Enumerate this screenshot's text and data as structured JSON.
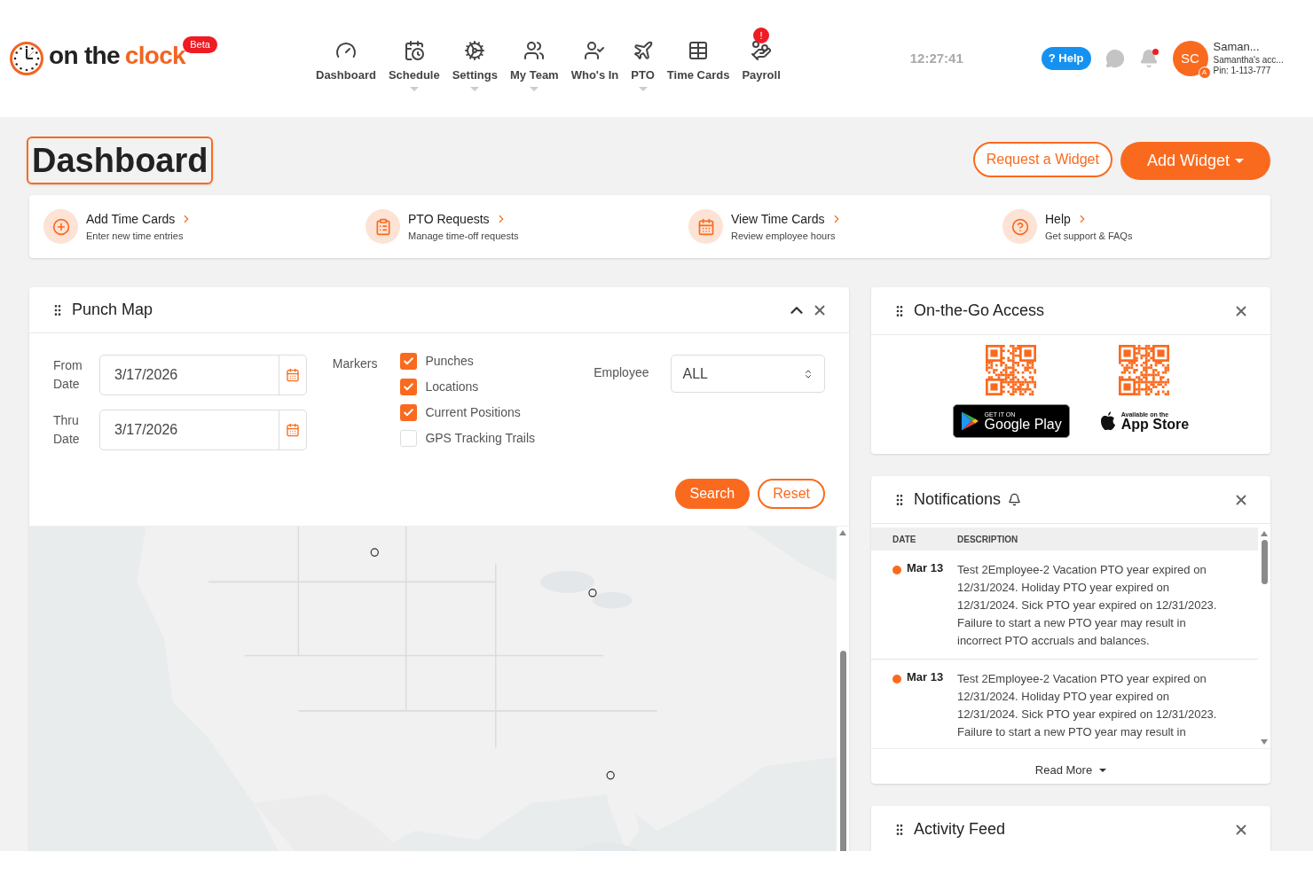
{
  "header": {
    "logo": {
      "word_1": "on the",
      "word_2": "clock",
      "badge": "Beta"
    },
    "nav": [
      {
        "label": "Dashboard",
        "has_menu": false
      },
      {
        "label": "Schedule",
        "has_menu": true
      },
      {
        "label": "Settings",
        "has_menu": true
      },
      {
        "label": "My Team",
        "has_menu": true
      },
      {
        "label": "Who's In",
        "has_menu": false
      },
      {
        "label": "PTO",
        "has_menu": true
      },
      {
        "label": "Time Cards",
        "has_menu": false
      },
      {
        "label": "Payroll",
        "has_menu": false,
        "badge": "!"
      }
    ],
    "clock": "12:27:41",
    "help_button": "? Help",
    "unread_alerts": true,
    "user": {
      "initials": "SC",
      "role_badge": "A",
      "name": "Saman...",
      "account": "Samantha's acc...",
      "pin": "Pin: 1-113-777"
    }
  },
  "page": {
    "title": "Dashboard",
    "buttons": {
      "request_widget": "Request a Widget",
      "add_widget": "Add Widget"
    }
  },
  "quick_links": [
    {
      "title": "Add Time Cards",
      "subtitle": "Enter new time entries"
    },
    {
      "title": "PTO Requests",
      "subtitle": "Manage time-off requests"
    },
    {
      "title": "View Time Cards",
      "subtitle": "Review employee hours"
    },
    {
      "title": "Help",
      "subtitle": "Get support & FAQs"
    }
  ],
  "punch_map": {
    "title": "Punch Map",
    "from_label": "From Date",
    "from_value": "3/17/2026",
    "thru_label": "Thru Date",
    "thru_value": "3/17/2026",
    "markers_label": "Markers",
    "markers": [
      {
        "label": "Punches",
        "checked": true
      },
      {
        "label": "Locations",
        "checked": true
      },
      {
        "label": "Current Positions",
        "checked": true
      },
      {
        "label": "GPS Tracking Trails",
        "checked": false
      }
    ],
    "employee_label": "Employee",
    "employee_value": "ALL",
    "search_button": "Search",
    "reset_button": "Reset"
  },
  "on_the_go": {
    "title": "On-the-Go Access",
    "google_play": {
      "small": "GET IT ON",
      "large": "Google Play"
    },
    "app_store": {
      "small": "Available on the",
      "large": "App Store"
    }
  },
  "notifications": {
    "title": "Notifications",
    "columns": [
      "DATE",
      "DESCRIPTION"
    ],
    "rows": [
      {
        "date": "Mar 13",
        "color": "#fa6a1e",
        "description": "Test 2Employee-2 Vacation PTO year expired on 12/31/2024. Holiday PTO year expired on 12/31/2024. Sick PTO year expired on 12/31/2023. Failure to start a new PTO year may result in incorrect PTO accruals and balances."
      },
      {
        "date": "Mar 13",
        "color": "#fa6a1e",
        "description": "Test 2Employee-2 Vacation PTO year expired on 12/31/2024. Holiday PTO year expired on 12/31/2024. Sick PTO year expired on 12/31/2023. Failure to start a new PTO year may result in"
      }
    ],
    "read_more": "Read More"
  },
  "activity_feed": {
    "title": "Activity Feed"
  }
}
